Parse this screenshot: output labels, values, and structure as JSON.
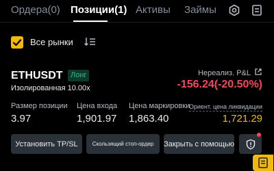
{
  "tabs": [
    {
      "label": "Ордера(0)",
      "active": false
    },
    {
      "label": "Позиции(1)",
      "active": true
    },
    {
      "label": "Активы",
      "active": false
    },
    {
      "label": "Займы",
      "active": false
    }
  ],
  "toolbar_icons": [
    "settings-icon",
    "document-icon"
  ],
  "filter": {
    "checked": true,
    "label": "Все рынки",
    "sort_icon": "sort-icon"
  },
  "position": {
    "symbol": "ETHUSDT",
    "side": "Лонг",
    "margin_mode": "Изолированная 10.00x",
    "pnl_label": "Нереализ. P&L",
    "pnl_value": "-156.24(-20.50%)",
    "stats": [
      {
        "label": "Размер позиции",
        "value": "3.97"
      },
      {
        "label": "Цена входа",
        "value": "1,901.97"
      },
      {
        "label": "Цена маркировки",
        "value": "1,863.40"
      },
      {
        "label": "Ориент. цена ликвидации",
        "value": "1,721.29"
      }
    ]
  },
  "actions": [
    {
      "label": "Установить TP/SL"
    },
    {
      "label": "Скользящий стоп-ордер"
    },
    {
      "label": "Закрыть с помощью"
    }
  ],
  "colors": {
    "accent": "#f0b90b",
    "loss": "#f6465d",
    "long": "#2ebd85"
  }
}
